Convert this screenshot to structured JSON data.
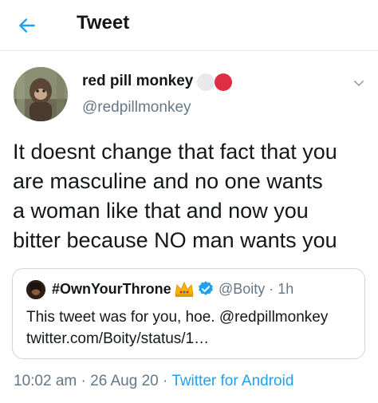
{
  "header": {
    "title": "Tweet",
    "back_icon": "arrow-left-icon"
  },
  "author": {
    "display_name": "red pill monkey",
    "handle": "@redpillmonkey",
    "name_emojis": [
      "white-circle-emoji",
      "red-circle-emoji"
    ],
    "menu_icon": "chevron-down-icon"
  },
  "tweet": {
    "text": "It doesnt change that fact that you\nare masculine and no one wants\na woman like that and now you\nbitter because NO man wants you"
  },
  "quoted_tweet": {
    "display_name": "#OwnYourThrone",
    "handle_time": "@Boity · 1h",
    "text": "This tweet was for you, hoe. @redpillmonkey\ntwitter.com/Boity/status/1…",
    "badges": [
      "crown-emoji",
      "verified-badge-icon"
    ]
  },
  "meta": {
    "time": "10:02 am",
    "date": "26 Aug 20",
    "separator": " · ",
    "source": "Twitter for Android"
  },
  "colors": {
    "accent": "#1da1f2",
    "secondary_text": "#657786",
    "border": "#ccd6dd"
  }
}
